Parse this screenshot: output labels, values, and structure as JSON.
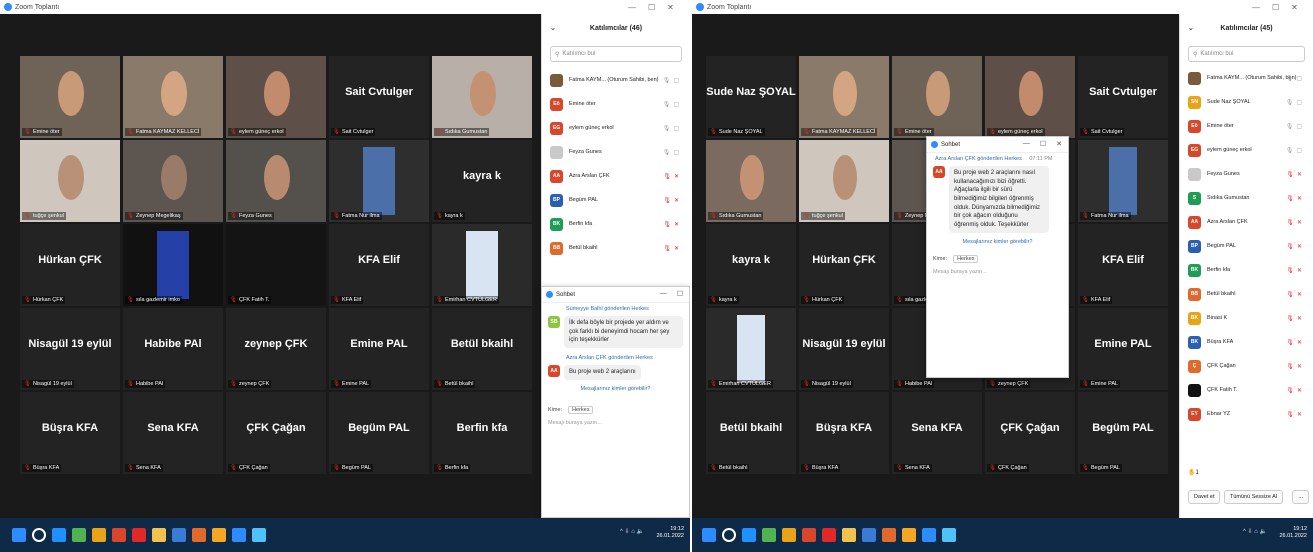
{
  "w1": {
    "title": "Zoom Toplantı",
    "participants_title": "Katılımcılar (46)",
    "search_placeholder": "Katılımcı bul",
    "tiles": [
      {
        "label": "Emine öter",
        "big": ""
      },
      {
        "label": "Fatma KAYMAZ KELLECİ",
        "big": ""
      },
      {
        "label": "eylem güneç erkol",
        "big": ""
      },
      {
        "label": "Sait Cvtulger",
        "big": "Sait Cvtulger"
      },
      {
        "label": "Sıdıka Gumustan",
        "big": ""
      },
      {
        "label": "tuğçe şenkul",
        "big": ""
      },
      {
        "label": "Zeynep Megelikaş",
        "big": ""
      },
      {
        "label": "Feyza Gunes",
        "big": ""
      },
      {
        "label": "Fatma Nur ilma",
        "big": ""
      },
      {
        "label": "kayra k",
        "big": "kayra k"
      },
      {
        "label": "Hürkan ÇFK",
        "big": "Hürkan ÇFK"
      },
      {
        "label": "sıla gazlemir imko",
        "big": ""
      },
      {
        "label": "ÇFK Fatih T.",
        "big": ""
      },
      {
        "label": "KFA Elif",
        "big": "KFA Elif"
      },
      {
        "label": "Emirhan CVTÜLGER",
        "big": ""
      },
      {
        "label": "Nisagül 19 eylül",
        "big": "Nisagül 19 eylül"
      },
      {
        "label": "Habibe PAl",
        "big": "Habibe PAl"
      },
      {
        "label": "zeynep ÇFK",
        "big": "zeynep ÇFK"
      },
      {
        "label": "Emine PAL",
        "big": "Emine PAL"
      },
      {
        "label": "Betül bkaihl",
        "big": "Betül bkaihl"
      },
      {
        "label": "Büşra KFA",
        "big": "Büşra KFA"
      },
      {
        "label": "Sena KFA",
        "big": "Sena KFA"
      },
      {
        "label": "ÇFK Çağan",
        "big": "ÇFK Çağan"
      },
      {
        "label": "Begüm PAL",
        "big": "Begüm PAL"
      },
      {
        "label": "Berfin kfa",
        "big": "Berfin kfa"
      }
    ],
    "participants": [
      {
        "initials": "",
        "name": "Fatma KAYM... (Oturum Sahibi, ben)",
        "color": "#7a5a3a"
      },
      {
        "initials": "Eö",
        "name": "Emine öter",
        "color": "#d9472b"
      },
      {
        "initials": "EG",
        "name": "eylem güneç erkol",
        "color": "#d9472b"
      },
      {
        "initials": "",
        "name": "Feyza Gunes",
        "color": "#c9c9c9"
      },
      {
        "initials": "AA",
        "name": "Azra Arslan ÇFK",
        "color": "#d9472b"
      },
      {
        "initials": "BP",
        "name": "Begüm PAL",
        "color": "#2b5fb0"
      },
      {
        "initials": "BK",
        "name": "Berfin kfa",
        "color": "#1f9d55"
      },
      {
        "initials": "BB",
        "name": "Betül bkaihl",
        "color": "#e06a2b"
      }
    ],
    "chat": {
      "title": "Sohbet",
      "m1_sender": "Sümeyye Balhl",
      "m1_to": "gönderilen Herkes",
      "m1_initials": "SB",
      "m1_text": "İlk defa böyle bir projede yer aldım ve çok farklı bi deneyimdi hocam her şey için teşekkürler",
      "m2_sender": "Azra Arslan ÇFK",
      "m2_to": "gönderilen Herkes",
      "m2_initials": "AA",
      "m2_text": "Bu proje web 2 araçlarını",
      "who_label": "Mesajlarınız kimler görebilir?",
      "to_label": "Kime:",
      "to_value": "Herkes",
      "input_placeholder": "Mesajı buraya yazın..."
    },
    "clock": {
      "time": "19:12",
      "date": "26.01.2022"
    }
  },
  "w2": {
    "title": "Zoom Toplantı",
    "participants_title": "Katılımcılar (45)",
    "search_placeholder": "Katılımcı bul",
    "tiles": [
      {
        "label": "Sude Naz ŞOYAL",
        "big": "Sude Naz ŞOYAL"
      },
      {
        "label": "Fatma KAYMAZ KELLECİ",
        "big": ""
      },
      {
        "label": "Emine öter",
        "big": ""
      },
      {
        "label": "eylem güneç erkol",
        "big": ""
      },
      {
        "label": "Sait Cvtulger",
        "big": "Sait Cvtulger"
      },
      {
        "label": "Sıdıka Gumustan",
        "big": ""
      },
      {
        "label": "tuğçe şenkul",
        "big": ""
      },
      {
        "label": "Zeynep Mege",
        "big": ""
      },
      {
        "label": "",
        "big": ""
      },
      {
        "label": "Fatma Nur ilma",
        "big": ""
      },
      {
        "label": "kayra k",
        "big": "kayra k"
      },
      {
        "label": "Hürkan ÇFK",
        "big": "Hürkan ÇFK"
      },
      {
        "label": "sıla gazlem",
        "big": ""
      },
      {
        "label": "",
        "big": ""
      },
      {
        "label": "KFA Elif",
        "big": "KFA Elif"
      },
      {
        "label": "Emirhan CVTÜLGER",
        "big": ""
      },
      {
        "label": "Nisagül 19 eylül",
        "big": "Nisagül 19 eylül"
      },
      {
        "label": "Habibe PAl",
        "big": "Hab"
      },
      {
        "label": "zeynep ÇFK",
        "big": ""
      },
      {
        "label": "Emine PAL",
        "big": "Emine PAL"
      },
      {
        "label": "Betül bkaihl",
        "big": "Betül bkaihl"
      },
      {
        "label": "Büşra KFA",
        "big": "Büşra KFA"
      },
      {
        "label": "Sena KFA",
        "big": "Sena KFA"
      },
      {
        "label": "ÇFK Çağan",
        "big": "ÇFK Çağan"
      },
      {
        "label": "Begüm PAL",
        "big": "Begüm PAL"
      }
    ],
    "participants": [
      {
        "initials": "",
        "name": "Fatma KAYM... (Oturum Sahibi, ben)",
        "color": "#7a5a3a"
      },
      {
        "initials": "SN",
        "name": "Sude Naz ŞOYAL",
        "color": "#e8a317"
      },
      {
        "initials": "Eö",
        "name": "Emine öter",
        "color": "#d9472b"
      },
      {
        "initials": "EG",
        "name": "eylem güneç erkol",
        "color": "#d9472b"
      },
      {
        "initials": "",
        "name": "Feyza Gunes",
        "color": "#c9c9c9"
      },
      {
        "initials": "S",
        "name": "Sıdıka Gumustan",
        "color": "#1f9d55"
      },
      {
        "initials": "AA",
        "name": "Azra Arslan ÇFK",
        "color": "#d9472b"
      },
      {
        "initials": "BP",
        "name": "Begüm PAL",
        "color": "#2b5fb0"
      },
      {
        "initials": "BK",
        "name": "Berfin kfa",
        "color": "#1f9d55"
      },
      {
        "initials": "BB",
        "name": "Betül bkaihl",
        "color": "#e06a2b"
      },
      {
        "initials": "BK",
        "name": "Binasi K",
        "color": "#e8a317"
      },
      {
        "initials": "BK",
        "name": "Büşra KFA",
        "color": "#2b5fb0"
      },
      {
        "initials": "Ç",
        "name": "ÇFK Çağan",
        "color": "#e06a2b"
      },
      {
        "initials": "",
        "name": "ÇFK Fatih T.",
        "color": "#111111"
      },
      {
        "initials": "EY",
        "name": "Ebnar YZ",
        "color": "#d9472b"
      }
    ],
    "chat": {
      "title": "Sohbet",
      "m1_sender": "Azra Arslan ÇFK",
      "m1_to": "gönderilen Herkes",
      "m1_time": "07:11 PM",
      "m1_initials": "AA",
      "m1_text": "Bu proje web 2 araçlarını nasıl kullanacağımızı bizi öğretti. Ağaçlarla ilgili bir sürü bilmediğimiz bilgileri öğrenmiş olduk. Dünyamızda bilmediğimiz bir çok ağacın olduğunu öğrenmiş olduk. Teşekkürler",
      "who_label": "Mesajlarınız kimler görebilir?",
      "to_label": "Kime:",
      "to_value": "Herkes",
      "input_placeholder": "Mesajı buraya yazın..."
    },
    "raise_count": "1",
    "invite_label": "Davet et",
    "mute_all_label": "Tümünü Sessize Al",
    "more_label": "...",
    "clock": {
      "time": "19:12",
      "date": "26.01.2022"
    }
  },
  "colors": {
    "accent": "#2d8cff",
    "active_speaker": "#a6d13c",
    "taskbar": "#0e2a47",
    "muted": "#e02828"
  },
  "icons": [
    "zoom-logo-icon",
    "minimize-icon",
    "maximize-icon",
    "close-icon",
    "chevron-down-icon",
    "search-icon",
    "mic-muted-icon",
    "video-off-icon",
    "windows-start-icon",
    "task-view-icon",
    "hand-raise-icon"
  ]
}
